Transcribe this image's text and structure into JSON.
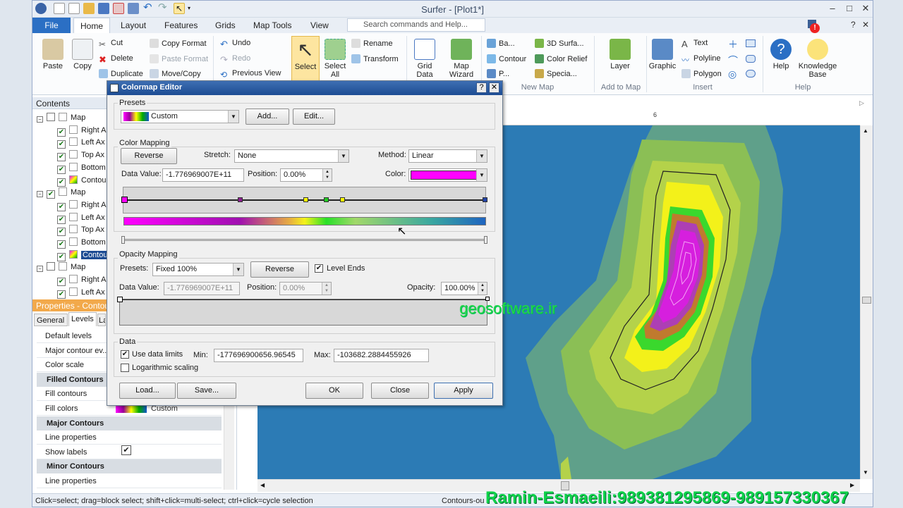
{
  "app": {
    "title": "Surfer - [Plot1*]"
  },
  "menu": {
    "file": "File",
    "tabs": [
      "Home",
      "Layout",
      "Features",
      "Grids",
      "Map Tools",
      "View"
    ],
    "search_placeholder": "Search commands and Help..."
  },
  "ribbon": {
    "clipboard": {
      "paste": "Paste",
      "copy": "Copy",
      "cut": "Cut",
      "delete": "Delete",
      "duplicate": "Duplicate",
      "copy_format": "Copy Format",
      "paste_format": "Paste Format",
      "move_copy": "Move/Copy"
    },
    "undo": {
      "undo": "Undo",
      "redo": "Redo",
      "previous_view": "Previous View"
    },
    "selection": {
      "select": "Select",
      "select_all": "Select All",
      "rename": "Rename",
      "transform": "Transform"
    },
    "grid": {
      "grid_data": "Grid Data",
      "map_wizard": "Map Wizard"
    },
    "new_map": {
      "base": "Ba...",
      "contour": "Contour",
      "post": "P...",
      "surface": "3D Surfa...",
      "color_relief": "Color Relief",
      "special": "Specia...",
      "label": "New Map"
    },
    "add_to_map": {
      "layer": "Layer",
      "label": "Add to Map"
    },
    "insert": {
      "graphic": "Graphic",
      "text": "Text",
      "polyline": "Polyline",
      "polygon": "Polygon",
      "label": "Insert"
    },
    "help": {
      "help": "Help",
      "knowledge_base": "Knowledge Base",
      "label": "Help"
    }
  },
  "contents": {
    "title": "Contents",
    "items": [
      {
        "label": "Map",
        "level": 0,
        "checked": false
      },
      {
        "label": "Right A",
        "level": 1,
        "checked": true
      },
      {
        "label": "Left Ax",
        "level": 1,
        "checked": true
      },
      {
        "label": "Top Ax",
        "level": 1,
        "checked": true
      },
      {
        "label": "Bottom",
        "level": 1,
        "checked": true
      },
      {
        "label": "Contou",
        "level": 1,
        "checked": true
      },
      {
        "label": "Map",
        "level": 0,
        "checked": true
      },
      {
        "label": "Right A",
        "level": 1,
        "checked": true
      },
      {
        "label": "Left Ax",
        "level": 1,
        "checked": true
      },
      {
        "label": "Top Ax",
        "level": 1,
        "checked": true
      },
      {
        "label": "Bottom",
        "level": 1,
        "checked": true
      },
      {
        "label": "Contou",
        "level": 1,
        "checked": true
      },
      {
        "label": "Map",
        "level": 0,
        "checked": false
      },
      {
        "label": "Right A",
        "level": 1,
        "checked": true
      },
      {
        "label": "Left Ax",
        "level": 1,
        "checked": true
      }
    ]
  },
  "properties": {
    "title": "Properties - Contour",
    "tabs": [
      "General",
      "Levels",
      "La"
    ],
    "rows": [
      {
        "type": "row",
        "label": "Default levels"
      },
      {
        "type": "row",
        "label": "Major contour ev..."
      },
      {
        "type": "row",
        "label": "Color scale"
      },
      {
        "type": "section",
        "label": "Filled Contours"
      },
      {
        "type": "row",
        "label": "Fill contours"
      },
      {
        "type": "row",
        "label": "Fill colors",
        "value": "Custom"
      },
      {
        "type": "section",
        "label": "Major Contours"
      },
      {
        "type": "row",
        "label": "Line properties"
      },
      {
        "type": "row",
        "label": "Show labels"
      },
      {
        "type": "section",
        "label": "Minor Contours"
      },
      {
        "type": "row",
        "label": "Line properties"
      }
    ]
  },
  "status": {
    "hint": "Click=select; drag=block select; shift+click=multi-select; ctrl+click=cycle selection",
    "layer": "Contours-ou"
  },
  "ruler": {
    "mark": "6"
  },
  "dialog": {
    "title": "Colormap Editor",
    "presets_group": "Presets",
    "preset_value": "Custom",
    "add": "Add...",
    "edit": "Edit...",
    "color_mapping": "Color Mapping",
    "reverse": "Reverse",
    "stretch_label": "Stretch:",
    "stretch_value": "None",
    "method_label": "Method:",
    "method_value": "Linear",
    "data_value_label": "Data Value:",
    "data_value": "-1.776969007E+11",
    "position_label": "Position:",
    "position_value": "0.00%",
    "color_label": "Color:",
    "color_value": "#ff00ff",
    "opacity_mapping": "Opacity Mapping",
    "op_presets_label": "Presets:",
    "op_preset_value": "Fixed 100%",
    "op_reverse": "Reverse",
    "level_ends": "Level Ends",
    "op_data_value_label": "Data Value:",
    "op_data_value": "-1.776969007E+11",
    "op_position_label": "Position:",
    "op_position_value": "0.00%",
    "opacity_label": "Opacity:",
    "opacity_value": "100.00%",
    "data_group": "Data",
    "use_limits": "Use data limits",
    "min_label": "Min:",
    "min_value": "-177696900656.96545",
    "max_label": "Max:",
    "max_value": "-103682.2884455926",
    "log_scaling": "Logarithmic scaling",
    "load": "Load...",
    "save": "Save...",
    "ok": "OK",
    "close": "Close",
    "apply": "Apply"
  },
  "watermarks": {
    "site": "geosoftware.ir",
    "contact": "Ramin-Esmaeili:989381295869-989157330367"
  },
  "colors": {
    "accent": "#2b6fc4",
    "water": "#2c7bb5",
    "magenta": "#ff00ff"
  }
}
